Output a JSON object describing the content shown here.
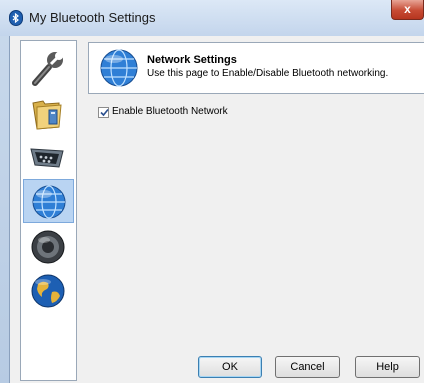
{
  "window": {
    "title": "My Bluetooth Settings",
    "close_label": "x"
  },
  "sidebar": {
    "items": [
      {
        "name": "general",
        "icon": "wrench-icon",
        "selected": false
      },
      {
        "name": "file-transfer",
        "icon": "folder-icon",
        "selected": false
      },
      {
        "name": "serial-port",
        "icon": "serial-port-icon",
        "selected": false
      },
      {
        "name": "network",
        "icon": "network-globe-icon",
        "selected": true
      },
      {
        "name": "audio",
        "icon": "speaker-icon",
        "selected": false
      },
      {
        "name": "internet",
        "icon": "earth-icon",
        "selected": false
      }
    ]
  },
  "header": {
    "title": "Network Settings",
    "description": "Use this page to Enable/Disable Bluetooth networking."
  },
  "settings": {
    "enable_network_label": "Enable Bluetooth Network",
    "enable_network_checked": true
  },
  "buttons": {
    "ok": "OK",
    "cancel": "Cancel",
    "help": "Help"
  },
  "colors": {
    "accent": "#1f5fb0",
    "selection": "#b9d4f2",
    "close_button": "#c74b34"
  }
}
